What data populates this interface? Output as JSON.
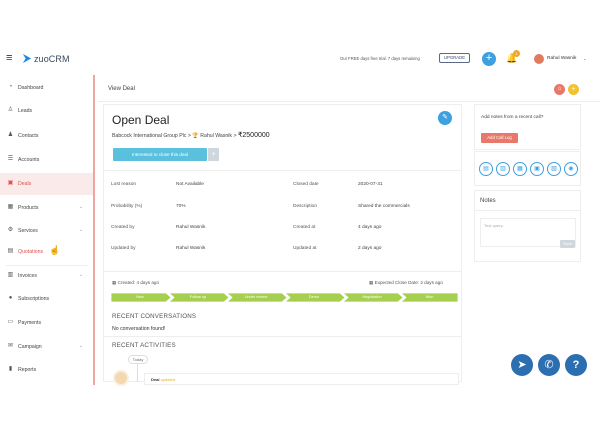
{
  "app": {
    "brand": "zuoCRM",
    "trial_text": "Our FREE days free trial. 7 days remaining",
    "upgrade_label": "UPGRADE",
    "plus_glyph": "+",
    "notification_count": "1",
    "user_name": "Rahul Wasnik",
    "hamburger_glyph": "≡",
    "bell_glyph": "🔔",
    "caret_glyph": "⌄"
  },
  "sidebar": {
    "items": [
      {
        "label": "Dashboard",
        "icon": "dashboard-icon",
        "glyph": "◔"
      },
      {
        "label": "Leads",
        "icon": "leads-icon",
        "glyph": "♙"
      },
      {
        "label": "Contacts",
        "icon": "contacts-icon",
        "glyph": "♟"
      },
      {
        "label": "Accounts",
        "icon": "accounts-icon",
        "glyph": "☰"
      },
      {
        "label": "Deals",
        "icon": "deals-icon",
        "glyph": "▣"
      },
      {
        "label": "Products",
        "icon": "products-icon",
        "glyph": "▦"
      },
      {
        "label": "Services",
        "icon": "services-icon",
        "glyph": "⚙"
      },
      {
        "label": "Quotations",
        "icon": "quotations-icon",
        "glyph": "▤"
      },
      {
        "label": "Invoices",
        "icon": "invoices-icon",
        "glyph": "▥"
      },
      {
        "label": "Subscriptions",
        "icon": "subscriptions-icon",
        "glyph": "●"
      },
      {
        "label": "Payments",
        "icon": "payments-icon",
        "glyph": "▭"
      },
      {
        "label": "Campaign",
        "icon": "campaign-icon",
        "glyph": "✉"
      },
      {
        "label": "Reports",
        "icon": "reports-icon",
        "glyph": "▮"
      }
    ],
    "chevron_glyph": "⌄"
  },
  "header": {
    "title": "View Deal",
    "red_btn_glyph": "⌂",
    "yellow_btn_glyph": "+"
  },
  "deal": {
    "title": "Open Deal",
    "edit_glyph": "✎",
    "breadcrumb_prefix": "Babcock International Group Plc > 🏆 Rahul Wasnik > ",
    "amount": "₹2500000",
    "interest_label": "Interested to close this deal",
    "interest_plus": "+",
    "fields": [
      {
        "label": "Lost reason",
        "value": "Not Available",
        "label2": "Closed date",
        "value2": "2020-07-31"
      },
      {
        "label": "Probability (%)",
        "value": "70%",
        "label2": "Description",
        "value2": "Shared the commercials"
      },
      {
        "label": "Created by",
        "value": "Rahul Wasnik",
        "label2": "Created at",
        "value2": "4 days ago"
      },
      {
        "label": "Updated by",
        "value": "Rahul Wasnik",
        "label2": "Updated at",
        "value2": "2 days ago"
      }
    ],
    "created_meta": "Created: 4 days ago",
    "expected_close": "Expected Close Date: 2 days ago",
    "stages": [
      "New",
      "Follow up",
      "Under review",
      "Demo",
      "Negotiation",
      "Won"
    ],
    "stage_color": "#a6cf4f",
    "recent_conversations_title": "RECENT CONVERSATIONS",
    "no_conversation": "No conversation found!",
    "recent_activities_title": "RECENT ACTIVITIES",
    "today_label": "Today",
    "activity_prefix": "Deal",
    "activity_highlight": "updated"
  },
  "right_panel": {
    "add_notes_prompt": "Add notes from a recent call?",
    "add_call_label": "Add Call Log",
    "quick_icons": [
      {
        "name": "notes-icon",
        "glyph": "▤"
      },
      {
        "name": "document-icon",
        "glyph": "▥"
      },
      {
        "name": "file-icon",
        "glyph": "▦"
      },
      {
        "name": "calendar-icon",
        "glyph": "▣"
      },
      {
        "name": "attachment-icon",
        "glyph": "▧"
      },
      {
        "name": "view-icon",
        "glyph": "◉"
      }
    ],
    "notes_title": "Notes",
    "notes_placeholder": "Text query...",
    "notes_save": "Save"
  },
  "fabs": {
    "telegram_glyph": "➤",
    "phone_glyph": "✆",
    "help_glyph": "?"
  },
  "colors": {
    "accent_blue": "#3da0e0",
    "accent_red": "#e8786a",
    "sidebar_active": "#d9534f",
    "fab_blue": "#2b6fb0"
  }
}
